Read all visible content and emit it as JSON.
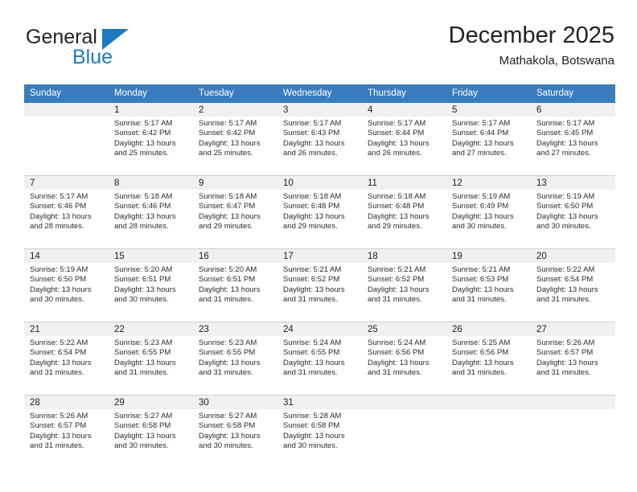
{
  "brand": {
    "name_part1": "General",
    "name_part2": "Blue",
    "accent_color": "#1c79c0"
  },
  "header": {
    "title": "December 2025",
    "subtitle": "Mathakola, Botswana",
    "header_bg_color": "#3a7cbe",
    "daynum_band_color": "#f0f0f0"
  },
  "weekdays": [
    "Sunday",
    "Monday",
    "Tuesday",
    "Wednesday",
    "Thursday",
    "Friday",
    "Saturday"
  ],
  "labels": {
    "sunrise_prefix": "Sunrise:",
    "sunset_prefix": "Sunset:",
    "daylight_prefix": "Daylight:"
  },
  "weeks": [
    [
      {
        "day": "",
        "sunrise": "",
        "sunset": "",
        "daylight_line1": "",
        "daylight_line2": "",
        "empty": true
      },
      {
        "day": "1",
        "sunrise": "Sunrise: 5:17 AM",
        "sunset": "Sunset: 6:42 PM",
        "daylight_line1": "Daylight: 13 hours",
        "daylight_line2": "and 25 minutes."
      },
      {
        "day": "2",
        "sunrise": "Sunrise: 5:17 AM",
        "sunset": "Sunset: 6:42 PM",
        "daylight_line1": "Daylight: 13 hours",
        "daylight_line2": "and 25 minutes."
      },
      {
        "day": "3",
        "sunrise": "Sunrise: 5:17 AM",
        "sunset": "Sunset: 6:43 PM",
        "daylight_line1": "Daylight: 13 hours",
        "daylight_line2": "and 26 minutes."
      },
      {
        "day": "4",
        "sunrise": "Sunrise: 5:17 AM",
        "sunset": "Sunset: 6:44 PM",
        "daylight_line1": "Daylight: 13 hours",
        "daylight_line2": "and 26 minutes."
      },
      {
        "day": "5",
        "sunrise": "Sunrise: 5:17 AM",
        "sunset": "Sunset: 6:44 PM",
        "daylight_line1": "Daylight: 13 hours",
        "daylight_line2": "and 27 minutes."
      },
      {
        "day": "6",
        "sunrise": "Sunrise: 5:17 AM",
        "sunset": "Sunset: 6:45 PM",
        "daylight_line1": "Daylight: 13 hours",
        "daylight_line2": "and 27 minutes."
      }
    ],
    [
      {
        "day": "7",
        "sunrise": "Sunrise: 5:17 AM",
        "sunset": "Sunset: 6:46 PM",
        "daylight_line1": "Daylight: 13 hours",
        "daylight_line2": "and 28 minutes."
      },
      {
        "day": "8",
        "sunrise": "Sunrise: 5:18 AM",
        "sunset": "Sunset: 6:46 PM",
        "daylight_line1": "Daylight: 13 hours",
        "daylight_line2": "and 28 minutes."
      },
      {
        "day": "9",
        "sunrise": "Sunrise: 5:18 AM",
        "sunset": "Sunset: 6:47 PM",
        "daylight_line1": "Daylight: 13 hours",
        "daylight_line2": "and 29 minutes."
      },
      {
        "day": "10",
        "sunrise": "Sunrise: 5:18 AM",
        "sunset": "Sunset: 6:48 PM",
        "daylight_line1": "Daylight: 13 hours",
        "daylight_line2": "and 29 minutes."
      },
      {
        "day": "11",
        "sunrise": "Sunrise: 5:18 AM",
        "sunset": "Sunset: 6:48 PM",
        "daylight_line1": "Daylight: 13 hours",
        "daylight_line2": "and 29 minutes."
      },
      {
        "day": "12",
        "sunrise": "Sunrise: 5:19 AM",
        "sunset": "Sunset: 6:49 PM",
        "daylight_line1": "Daylight: 13 hours",
        "daylight_line2": "and 30 minutes."
      },
      {
        "day": "13",
        "sunrise": "Sunrise: 5:19 AM",
        "sunset": "Sunset: 6:50 PM",
        "daylight_line1": "Daylight: 13 hours",
        "daylight_line2": "and 30 minutes."
      }
    ],
    [
      {
        "day": "14",
        "sunrise": "Sunrise: 5:19 AM",
        "sunset": "Sunset: 6:50 PM",
        "daylight_line1": "Daylight: 13 hours",
        "daylight_line2": "and 30 minutes."
      },
      {
        "day": "15",
        "sunrise": "Sunrise: 5:20 AM",
        "sunset": "Sunset: 6:51 PM",
        "daylight_line1": "Daylight: 13 hours",
        "daylight_line2": "and 30 minutes."
      },
      {
        "day": "16",
        "sunrise": "Sunrise: 5:20 AM",
        "sunset": "Sunset: 6:51 PM",
        "daylight_line1": "Daylight: 13 hours",
        "daylight_line2": "and 31 minutes."
      },
      {
        "day": "17",
        "sunrise": "Sunrise: 5:21 AM",
        "sunset": "Sunset: 6:52 PM",
        "daylight_line1": "Daylight: 13 hours",
        "daylight_line2": "and 31 minutes."
      },
      {
        "day": "18",
        "sunrise": "Sunrise: 5:21 AM",
        "sunset": "Sunset: 6:52 PM",
        "daylight_line1": "Daylight: 13 hours",
        "daylight_line2": "and 31 minutes."
      },
      {
        "day": "19",
        "sunrise": "Sunrise: 5:21 AM",
        "sunset": "Sunset: 6:53 PM",
        "daylight_line1": "Daylight: 13 hours",
        "daylight_line2": "and 31 minutes."
      },
      {
        "day": "20",
        "sunrise": "Sunrise: 5:22 AM",
        "sunset": "Sunset: 6:54 PM",
        "daylight_line1": "Daylight: 13 hours",
        "daylight_line2": "and 31 minutes."
      }
    ],
    [
      {
        "day": "21",
        "sunrise": "Sunrise: 5:22 AM",
        "sunset": "Sunset: 6:54 PM",
        "daylight_line1": "Daylight: 13 hours",
        "daylight_line2": "and 31 minutes."
      },
      {
        "day": "22",
        "sunrise": "Sunrise: 5:23 AM",
        "sunset": "Sunset: 6:55 PM",
        "daylight_line1": "Daylight: 13 hours",
        "daylight_line2": "and 31 minutes."
      },
      {
        "day": "23",
        "sunrise": "Sunrise: 5:23 AM",
        "sunset": "Sunset: 6:55 PM",
        "daylight_line1": "Daylight: 13 hours",
        "daylight_line2": "and 31 minutes."
      },
      {
        "day": "24",
        "sunrise": "Sunrise: 5:24 AM",
        "sunset": "Sunset: 6:55 PM",
        "daylight_line1": "Daylight: 13 hours",
        "daylight_line2": "and 31 minutes."
      },
      {
        "day": "25",
        "sunrise": "Sunrise: 5:24 AM",
        "sunset": "Sunset: 6:56 PM",
        "daylight_line1": "Daylight: 13 hours",
        "daylight_line2": "and 31 minutes."
      },
      {
        "day": "26",
        "sunrise": "Sunrise: 5:25 AM",
        "sunset": "Sunset: 6:56 PM",
        "daylight_line1": "Daylight: 13 hours",
        "daylight_line2": "and 31 minutes."
      },
      {
        "day": "27",
        "sunrise": "Sunrise: 5:26 AM",
        "sunset": "Sunset: 6:57 PM",
        "daylight_line1": "Daylight: 13 hours",
        "daylight_line2": "and 31 minutes."
      }
    ],
    [
      {
        "day": "28",
        "sunrise": "Sunrise: 5:26 AM",
        "sunset": "Sunset: 6:57 PM",
        "daylight_line1": "Daylight: 13 hours",
        "daylight_line2": "and 31 minutes."
      },
      {
        "day": "29",
        "sunrise": "Sunrise: 5:27 AM",
        "sunset": "Sunset: 6:58 PM",
        "daylight_line1": "Daylight: 13 hours",
        "daylight_line2": "and 30 minutes."
      },
      {
        "day": "30",
        "sunrise": "Sunrise: 5:27 AM",
        "sunset": "Sunset: 6:58 PM",
        "daylight_line1": "Daylight: 13 hours",
        "daylight_line2": "and 30 minutes."
      },
      {
        "day": "31",
        "sunrise": "Sunrise: 5:28 AM",
        "sunset": "Sunset: 6:58 PM",
        "daylight_line1": "Daylight: 13 hours",
        "daylight_line2": "and 30 minutes."
      },
      {
        "day": "",
        "sunrise": "",
        "sunset": "",
        "daylight_line1": "",
        "daylight_line2": "",
        "empty": true
      },
      {
        "day": "",
        "sunrise": "",
        "sunset": "",
        "daylight_line1": "",
        "daylight_line2": "",
        "empty": true
      },
      {
        "day": "",
        "sunrise": "",
        "sunset": "",
        "daylight_line1": "",
        "daylight_line2": "",
        "empty": true
      }
    ]
  ]
}
